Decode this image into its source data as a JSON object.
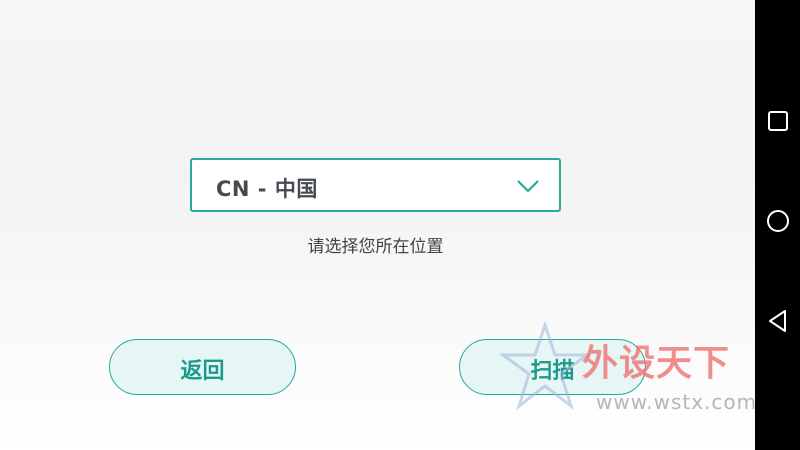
{
  "region_select": {
    "value": "CN - 中国",
    "hint": "请选择您所在位置"
  },
  "buttons": {
    "back_label": "返回",
    "scan_label": "扫描"
  },
  "watermark": {
    "logo_text": "外设天下",
    "url_text": "www.wstx.com"
  },
  "system_nav": {
    "icons": [
      "recents-icon",
      "home-icon",
      "back-icon"
    ]
  },
  "colors": {
    "accent": "#2aa89a",
    "button_fill": "#e6f6f4",
    "navbar": "#000000"
  }
}
